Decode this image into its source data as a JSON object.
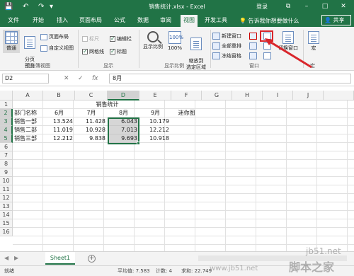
{
  "titlebar": {
    "title": "销售统计.xlsx - Excel",
    "login": "登录",
    "restore_glyph": "⧉",
    "minimize_glyph": "–",
    "maximize_glyph": "□",
    "close_glyph": "✕",
    "save_glyph": "💾",
    "undo_glyph": "↶",
    "redo_glyph": "↷",
    "customize_glyph": "▾"
  },
  "tabs": [
    "文件",
    "开始",
    "插入",
    "页面布局",
    "公式",
    "数据",
    "审阅",
    "视图",
    "开发工具"
  ],
  "active_tab": "视图",
  "tellme": "告诉我你想要做什么",
  "share": "共享",
  "ribbon": {
    "workbook_views": {
      "normal": "普通",
      "page_break": "分页\n预览",
      "page_layout": "页面布局",
      "custom_views": "自定义视图",
      "label": "工作簿视图"
    },
    "show": {
      "ruler": "标尺",
      "formula_bar": "编辑栏",
      "gridlines": "网格线",
      "headings": "标题",
      "label": "显示"
    },
    "zoom": {
      "zoom": "显示比例",
      "zoom100": "100%",
      "zoom_selection": "缩放到\n选定区域",
      "label": "显示比例"
    },
    "window": {
      "new_window": "新建窗口",
      "arrange_all": "全部重排",
      "freeze_panes": "冻结窗格",
      "switch_windows": "切换窗口",
      "label": "窗口"
    },
    "macros": {
      "label": "宏"
    }
  },
  "formula_bar": {
    "name_box": "D2",
    "cancel": "✕",
    "enter": "✓",
    "fx": "fx",
    "value": "8月"
  },
  "columns": [
    "A",
    "B",
    "C",
    "D",
    "E",
    "F",
    "G",
    "H",
    "I",
    "J"
  ],
  "rows": [
    "1",
    "2",
    "3",
    "4",
    "5",
    "6",
    "7",
    "8",
    "9",
    "10",
    "11",
    "12",
    "13",
    "14",
    "15",
    "16"
  ],
  "sheet": {
    "title": "销售统计",
    "headers": [
      "部门名称",
      "6月",
      "7月",
      "8月",
      "9月",
      "迷你图"
    ],
    "data": [
      [
        "销售一部",
        "13.524",
        "11.428",
        "6.043",
        "10.179"
      ],
      [
        "销售二部",
        "11.019",
        "10.928",
        "7.013",
        "12.212"
      ],
      [
        "销售三部",
        "12.212",
        "9.838",
        "9.693",
        "10.918"
      ]
    ]
  },
  "sheet_tabs": [
    "Sheet1"
  ],
  "status": {
    "ready": "就绪",
    "average": "平均值: 7.583",
    "count": "计数: 4",
    "sum": "求和: 22.749"
  },
  "watermark": {
    "site": "jb51.net",
    "brand": "脚本之家",
    "url": "www.jb51.net"
  },
  "colors": {
    "excel_green": "#217346",
    "annotation_red": "#d9262c"
  }
}
